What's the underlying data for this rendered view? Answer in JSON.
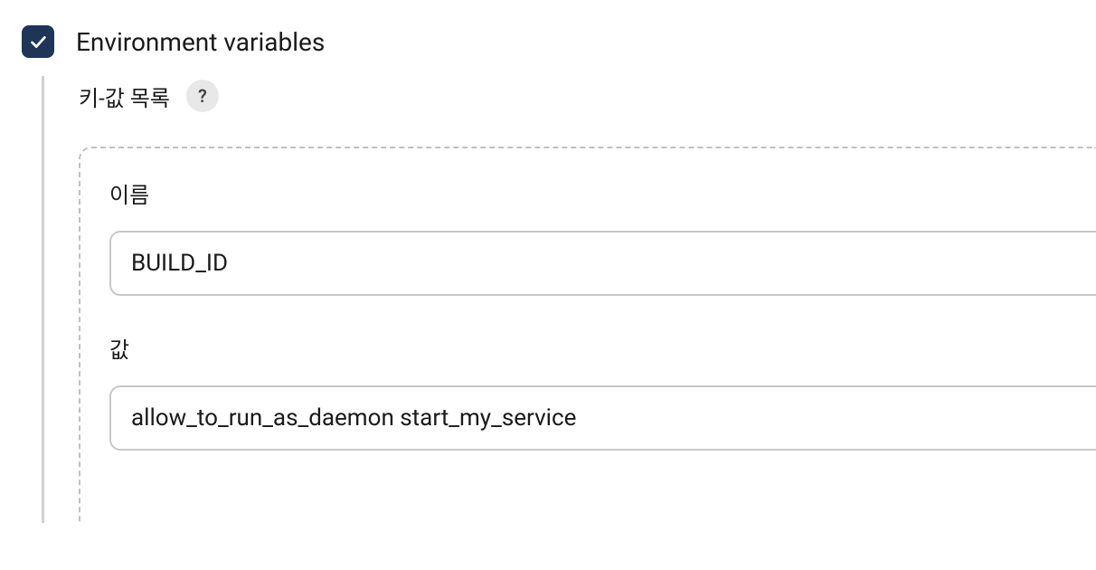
{
  "section": {
    "title": "Environment variables",
    "checked": true
  },
  "subsection": {
    "label": "키-값 목록",
    "help_symbol": "?"
  },
  "fields": {
    "name": {
      "label": "이름",
      "value": "BUILD_ID"
    },
    "value": {
      "label": "값",
      "value": "allow_to_run_as_daemon start_my_service"
    }
  }
}
